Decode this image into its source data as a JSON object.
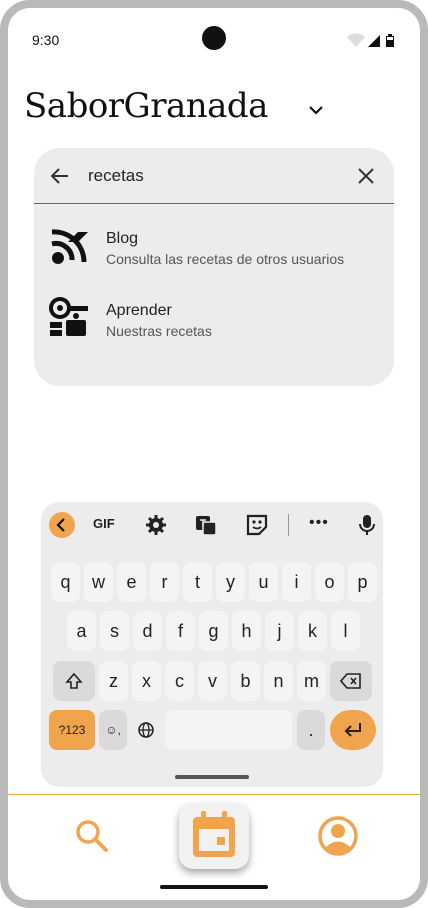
{
  "status_bar": {
    "time": "9:30"
  },
  "header": {
    "app_title": "SaborGranada"
  },
  "search": {
    "query": "recetas",
    "results": [
      {
        "title": "Blog",
        "subtitle": "Consulta las recetas de otros usuarios",
        "icon": "rss-feed-icon"
      },
      {
        "title": "Aprender",
        "subtitle": "Nuestras recetas",
        "icon": "cooking-icon"
      }
    ]
  },
  "keyboard": {
    "toolbar": {
      "gif_label": "GIF",
      "more_label": "•••"
    },
    "row1": [
      "q",
      "w",
      "e",
      "r",
      "t",
      "y",
      "u",
      "i",
      "o",
      "p"
    ],
    "row2": [
      "a",
      "s",
      "d",
      "f",
      "g",
      "h",
      "j",
      "k",
      "l"
    ],
    "row3": [
      "z",
      "x",
      "c",
      "v",
      "b",
      "n",
      "m"
    ],
    "symbols_label": "?123",
    "emoji_label": "☺,",
    "period_label": "."
  },
  "colors": {
    "accent": "#f0a44e",
    "panel": "#ececec"
  },
  "bottom_nav": {
    "items": [
      {
        "name": "search",
        "icon": "search-icon"
      },
      {
        "name": "calendar",
        "icon": "calendar-icon"
      },
      {
        "name": "profile",
        "icon": "account-icon"
      }
    ]
  }
}
